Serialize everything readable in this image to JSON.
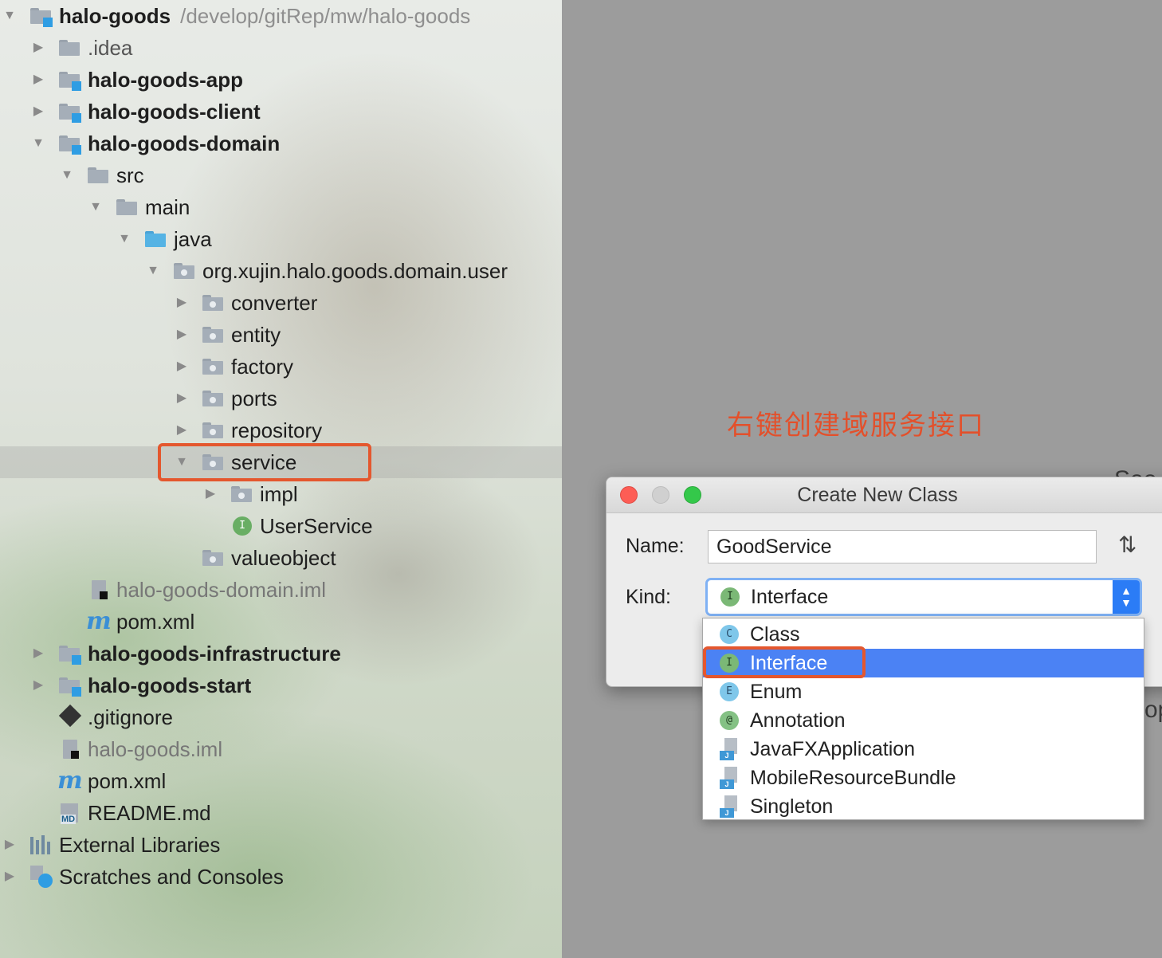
{
  "tree": {
    "root": {
      "label": "halo-goods",
      "path": "/develop/gitRep/mw/halo-goods"
    },
    "items": [
      {
        "label": ".idea"
      },
      {
        "label": "halo-goods-app"
      },
      {
        "label": "halo-goods-client"
      },
      {
        "label": "halo-goods-domain"
      },
      {
        "label": "src"
      },
      {
        "label": "main"
      },
      {
        "label": "java"
      },
      {
        "label": "org.xujin.halo.goods.domain.user"
      },
      {
        "label": "converter"
      },
      {
        "label": "entity"
      },
      {
        "label": "factory"
      },
      {
        "label": "ports"
      },
      {
        "label": "repository"
      },
      {
        "label": "service"
      },
      {
        "label": "impl"
      },
      {
        "label": "UserService"
      },
      {
        "label": "valueobject"
      },
      {
        "label": "halo-goods-domain.iml"
      },
      {
        "label": "pom.xml"
      },
      {
        "label": "halo-goods-infrastructure"
      },
      {
        "label": "halo-goods-start"
      },
      {
        "label": ".gitignore"
      },
      {
        "label": "halo-goods.iml"
      },
      {
        "label": "pom.xml"
      },
      {
        "label": "README.md"
      },
      {
        "label": "External Libraries"
      },
      {
        "label": "Scratches and Consoles"
      }
    ],
    "selected": "service"
  },
  "annotation": "右键创建域服务接口",
  "edge_fragments": {
    "top": "Soo",
    "middle": "op"
  },
  "dialog": {
    "title": "Create New Class",
    "name_label": "Name:",
    "name_value": "GoodService",
    "kind_label": "Kind:",
    "kind_value": "Interface",
    "kind_icon_letter": "I",
    "options": [
      {
        "label": "Class",
        "icon": "C",
        "selected": false
      },
      {
        "label": "Interface",
        "icon": "I",
        "selected": true
      },
      {
        "label": "Enum",
        "icon": "E",
        "selected": false
      },
      {
        "label": "Annotation",
        "icon": "@",
        "selected": false
      },
      {
        "label": "JavaFXApplication",
        "icon": "java-file-icon",
        "selected": false
      },
      {
        "label": "MobileResourceBundle",
        "icon": "java-file-icon",
        "selected": false
      },
      {
        "label": "Singleton",
        "icon": "java-file-icon",
        "selected": false
      }
    ]
  },
  "colors": {
    "annotation": "#e3502b",
    "highlight": "#e4572e",
    "selection": "#4b82f4"
  }
}
